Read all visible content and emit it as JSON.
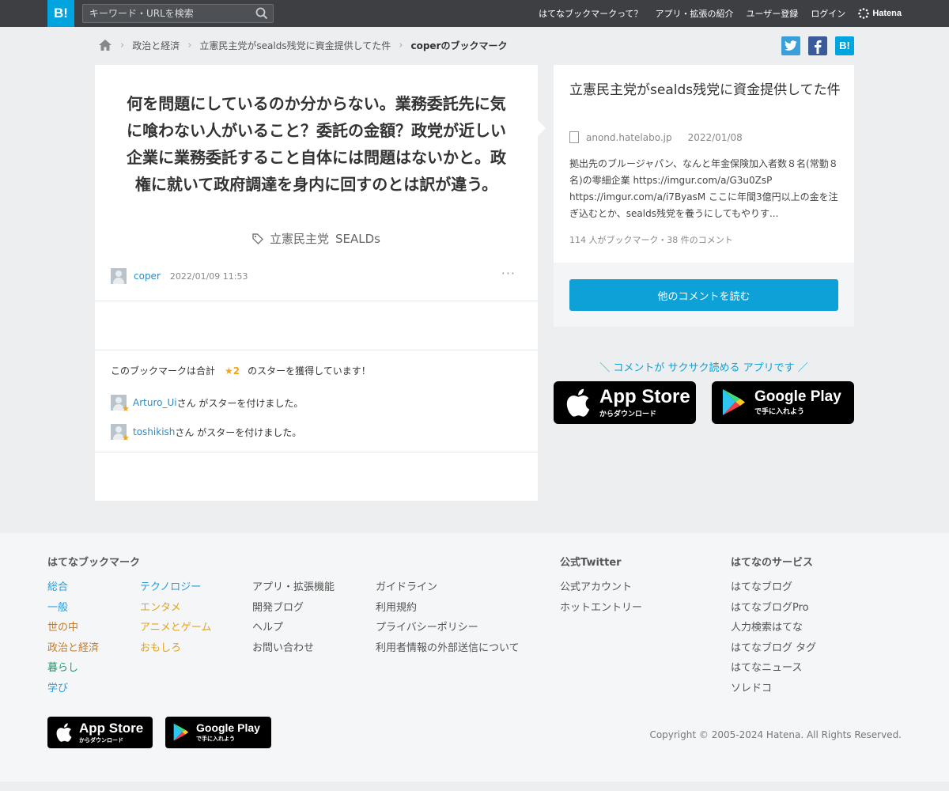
{
  "header": {
    "logo": "B!",
    "search_placeholder": "キーワード・URLを検索",
    "nav": [
      "はてなブックマークって？",
      "アプリ・拡張の紹介",
      "ユーザー登録",
      "ログイン"
    ],
    "brand": "Hatena"
  },
  "breadcrumb": {
    "items": [
      "政治と経済",
      "立憲民主党がsealds残党に資金提供してた件"
    ],
    "current": "coperのブックマーク"
  },
  "share": {
    "hatena_label": "B!"
  },
  "bookmark": {
    "comment": "何を問題にしているのか分からない。業務委託先に気に喰わない人がいること？委託の金額？政党が近しい企業に業務委託すること自体には問題はないかと。政権に就いて政府調達を身内に回すのとは訳が違う。",
    "tags": [
      "立憲民主党",
      "SEALDs"
    ],
    "user": "coper",
    "datetime": "2022/01/09 11:53",
    "more": "···"
  },
  "stars": {
    "prefix": "このブックマークは合計",
    "count": "★2",
    "suffix": "のスターを獲得しています！",
    "color": "#f2a614",
    "givers": [
      {
        "name": "Arturo_Ui",
        "text": "さん がスターを付けました。"
      },
      {
        "name": "toshikish",
        "text": "さん がスターを付けました。"
      }
    ]
  },
  "entry": {
    "title": "立憲民主党がsealds残党に資金提供してた件",
    "domain": "anond.hatelabo.jp",
    "date": "2022/01/08",
    "description": "拠出先のブルージャパン、なんと年金保険加入者数８名(常勤８名)の零細企業 https://imgur.com/a/G3u0ZsP https://imgur.com/a/i7ByasM ここに年間3億円以上の金を注ぎ込むとか、sealds残党を養うにしてもやりす...",
    "count": "114 人がブックマーク・38 件のコメント",
    "read_button": "他のコメントを読む",
    "accent": "#0ea1d8"
  },
  "app_promo": {
    "text": "＼ コメントが サクサク読める アプリです ／",
    "appstore_big": "App Store",
    "appstore_small": "からダウンロード",
    "googleplay_big": "Google Play",
    "googleplay_small": "で手に入れよう"
  },
  "footer": {
    "heading_bookmark": "はてなブックマーク",
    "col1": [
      {
        "label": "総合",
        "color": "#2a9bd6"
      },
      {
        "label": "一般",
        "color": "#2a9bd6"
      },
      {
        "label": "世の中",
        "color": "#c57a2a"
      },
      {
        "label": "政治と経済",
        "color": "#c57a2a"
      },
      {
        "label": "暮らし",
        "color": "#25946a"
      },
      {
        "label": "学び",
        "color": "#2a9bd6"
      }
    ],
    "col2": [
      {
        "label": "テクノロジー",
        "color": "#2a9bd6"
      },
      {
        "label": "エンタメ",
        "color": "#e5a21a"
      },
      {
        "label": "アニメとゲーム",
        "color": "#e5a21a"
      },
      {
        "label": "おもしろ",
        "color": "#e5a21a"
      }
    ],
    "col3": [
      "アプリ・拡張機能",
      "開発ブログ",
      "ヘルプ",
      "お問い合わせ"
    ],
    "col4": [
      "ガイドライン",
      "利用規約",
      "プライバシーポリシー",
      "利用者情報の外部送信について"
    ],
    "heading_twitter": "公式Twitter",
    "twitter": [
      "公式アカウント",
      "ホットエントリー"
    ],
    "heading_services": "はてなのサービス",
    "services": [
      "はてなブログ",
      "はてなブログPro",
      "人力検索はてな",
      "はてなブログ タグ",
      "はてなニュース",
      "ソレドコ"
    ],
    "copyright": "Copyright © 2005-2024 Hatena. All Rights Reserved."
  }
}
